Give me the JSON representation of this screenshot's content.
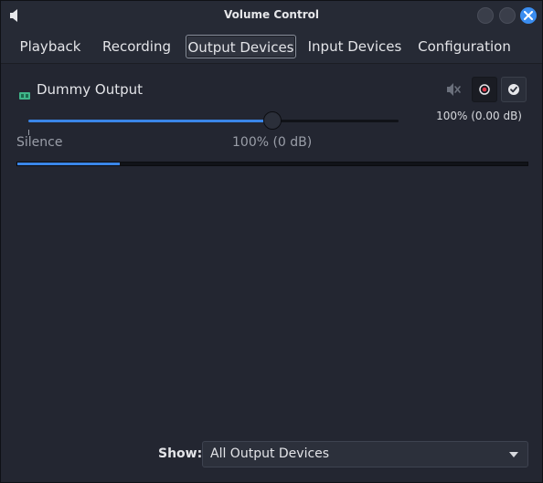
{
  "window": {
    "title": "Volume Control",
    "app_icon": "speaker-icon",
    "controls": [
      "minimize-button",
      "maximize-button",
      "close-button"
    ],
    "accent_color": "#3a8df0"
  },
  "tabs": [
    {
      "label": "Playback",
      "active": false
    },
    {
      "label": "Recording",
      "active": false
    },
    {
      "label": "Output Devices",
      "active": true
    },
    {
      "label": "Input Devices",
      "active": false
    },
    {
      "label": "Configuration",
      "active": false
    }
  ],
  "device": {
    "name": "Dummy Output",
    "icon": "sound-card-icon",
    "mute_icon": "speaker-muted-icon",
    "lock_icon": "lock-channels-icon",
    "default_icon": "set-default-check-icon",
    "volume_readout": "100% (0.00 dB)",
    "volume_percent": 100,
    "slider_position": 0.66,
    "tick_silence": "Silence",
    "tick_full": "100% (0 dB)",
    "peak_level": 0.2
  },
  "footer": {
    "show_label": "Show:",
    "show_value": "All Output Devices"
  }
}
